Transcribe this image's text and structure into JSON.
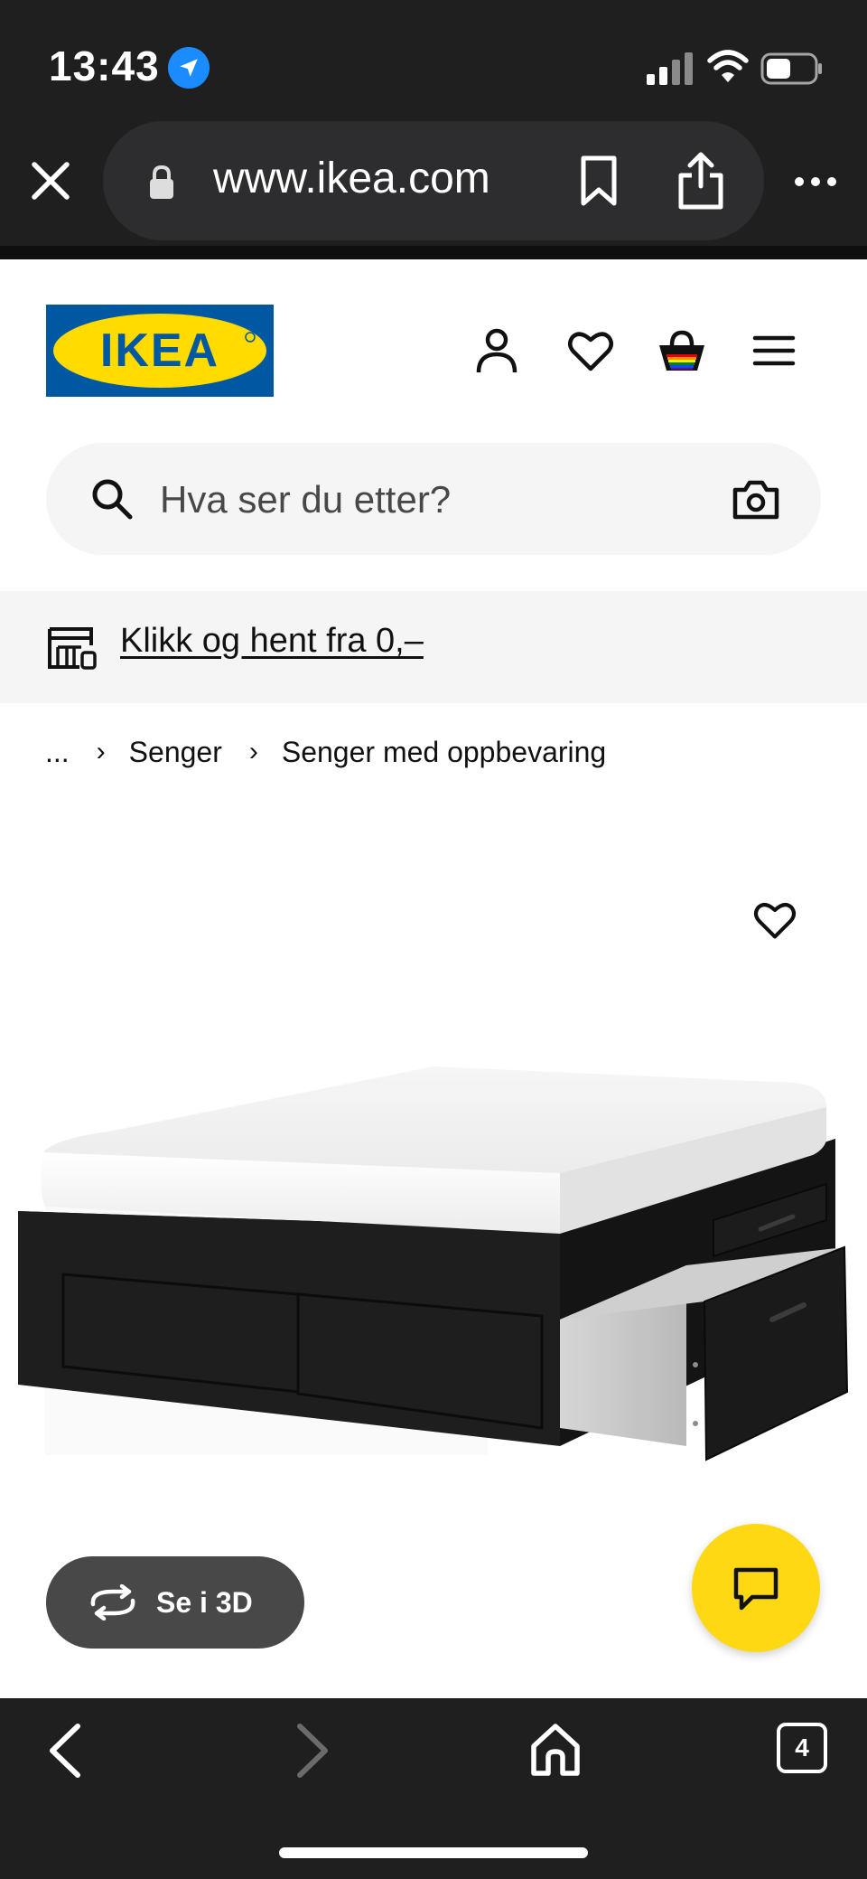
{
  "status_bar": {
    "time": "13:43"
  },
  "browser": {
    "url": "www.ikea.com",
    "open_tabs": "4"
  },
  "header": {
    "logo_text": "IKEA",
    "search": {
      "placeholder": "Hva ser du etter?"
    }
  },
  "banner": {
    "text": "Klikk og hent fra 0,–"
  },
  "breadcrumb": {
    "ellipsis": "...",
    "items": [
      "Senger",
      "Senger med oppbevaring"
    ]
  },
  "product": {
    "view_3d_label": "Se i 3D"
  },
  "colors": {
    "brand_blue": "#0058a3",
    "brand_yellow": "#ffdb00",
    "chat_yellow": "#ffd814",
    "chrome_dark": "#1f1f1f",
    "location_blue": "#1a8cff"
  },
  "icons": {
    "status": [
      "location-icon",
      "signal-icon",
      "wifi-icon",
      "battery-icon"
    ],
    "header": [
      "account-icon",
      "heart-icon",
      "shopping-bag-icon",
      "hamburger-menu-icon"
    ],
    "search": [
      "search-icon",
      "camera-icon"
    ],
    "toolbar": [
      "chevron-left-icon",
      "chevron-right-icon",
      "home-icon"
    ]
  }
}
